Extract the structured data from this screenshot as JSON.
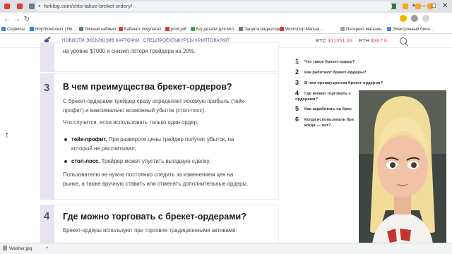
{
  "browser": {
    "tabs": [
      {
        "color": "#e53935"
      },
      {
        "color": "#e53935"
      },
      {
        "color": "#607d8b"
      },
      {
        "color": "#1e88e5"
      },
      {
        "color": "#34a853"
      },
      {
        "color": "#e53935"
      },
      {
        "color": "#4285f4"
      },
      {
        "color": "#4285f4"
      },
      {
        "color": "#607d8b"
      },
      {
        "color": "#5a6fb0"
      },
      {
        "color": "#e53935"
      },
      {
        "color": "#9e9e9e"
      },
      {
        "color": "#4285f4"
      },
      {
        "color": "#e53935"
      },
      {
        "color": "#6a1b9a"
      },
      {
        "color": "#e53935"
      },
      {
        "color": "#9e9e9e"
      },
      {
        "color": "#607d8b"
      },
      {
        "color": "#34a853"
      },
      {
        "color": "#9e9e9e"
      },
      {
        "color": "#9e9e9e"
      },
      {
        "color": "#4285f4"
      },
      {
        "color": "#e53935"
      },
      {
        "color": "#f9a825"
      },
      {
        "color": "#f9a825"
      },
      {
        "color": "#f9a825"
      },
      {
        "color": "#f9a825",
        "active": true
      },
      {
        "color": "#f9a825"
      },
      {
        "color": "#f9a825"
      },
      {
        "color": "#f9a825"
      },
      {
        "color": "#f9a825"
      },
      {
        "color": "#2e7d32"
      },
      {
        "color": "#f9a825"
      },
      {
        "color": "#f9a825"
      },
      {
        "color": "#f9a825"
      }
    ],
    "window_controls": {
      "new_tab": "+",
      "minimize": "–",
      "maximize": "□",
      "close": "✕"
    },
    "nav": {
      "back": "←",
      "forward": "→",
      "reload": "↻"
    },
    "url": "forklog.com/chto-takoe-breket-ordery/",
    "bookmarks": [
      {
        "label": "Сервисы",
        "color": "#4285f4"
      },
      {
        "label": "НоутКомплект | Но...",
        "color": "#1e88e5"
      },
      {
        "label": "Личный кабинет",
        "color": "#607d8b"
      },
      {
        "label": "Кабинет покупател...",
        "color": "#e53935"
      },
      {
        "label": "print.pdf",
        "color": "#e53935"
      },
      {
        "label": "Б/у детали для мот...",
        "color": "#34a853"
      },
      {
        "label": "Защита радиатора...",
        "color": "#607d8b"
      },
      {
        "label": "Workshop Manual...",
        "color": "#e53935"
      },
      {
        "label": "Интернет магазин...",
        "color": "#9e9e9e"
      },
      {
        "label": "Электронный биле...",
        "color": "#4285f4"
      }
    ]
  },
  "site": {
    "nav": [
      "НОВОСТИ",
      "ЭКСКЛЮЗИВ",
      "КАРТОЧКИ",
      "СПЕЦПРОЕКТЫ",
      "КУРСЫ КРИПТОВАЛЮТ"
    ],
    "prices": {
      "btc_label": "BTC",
      "btc_value": "$11351.33",
      "eth_label": "ETH",
      "eth_value": "$367.6"
    },
    "accent_color": "#e0506b"
  },
  "article": {
    "prev_tail": "на уровне $7000 и снизил потери трейдера на 20%.",
    "section3": {
      "number": "3",
      "title": "В чем преимущества брекет-ордеров?",
      "p1_line1": "С брекет-ордерами трейдер сразу определяет искомую прибыль (тейк-",
      "p1_line2": "профит) и максимально возможный убыток (стоп-лосс).",
      "p2": "Что случится, если использовать только один ордер:",
      "bullet1_bold": "тейк-профит.",
      "bullet1_line1": " При развороте цены трейдер получит убыток, на",
      "bullet1_line2": "который не рассчитывал;",
      "bullet2_bold": "стоп-лосс.",
      "bullet2_text": " Трейдер может упустить выгодную сделку.",
      "p3_line1": "Пользователю не нужно постоянно следить за изменением цен на",
      "p3_line2": "рынке, а также вручную ставить или отменять дополнительные ордеры."
    },
    "section4": {
      "number": "4",
      "title": "Где можно торговать с брекет-ордерами?",
      "p1": "Брекет-ордеры используют при торговле традиционными активами:"
    }
  },
  "toc": [
    {
      "n": "1",
      "lines": [
        "Что такое брекет-ордер?"
      ]
    },
    {
      "n": "2",
      "lines": [
        "Как работают брекет-ордеры?"
      ]
    },
    {
      "n": "3",
      "lines": [
        "В чем преимущества брекет-ордеров?"
      ]
    },
    {
      "n": "4",
      "lines": [
        "Где можно торговать с",
        "ордерами?"
      ]
    },
    {
      "n": "5",
      "lines": [
        "Как заработать на брек"
      ]
    },
    {
      "n": "6",
      "lines": [
        "Когда использовать бре",
        "когда — нет?"
      ]
    }
  ],
  "downloads": {
    "file": "Washer.jpg",
    "menu": "^"
  },
  "icons": {
    "back_to_top": "↑"
  }
}
